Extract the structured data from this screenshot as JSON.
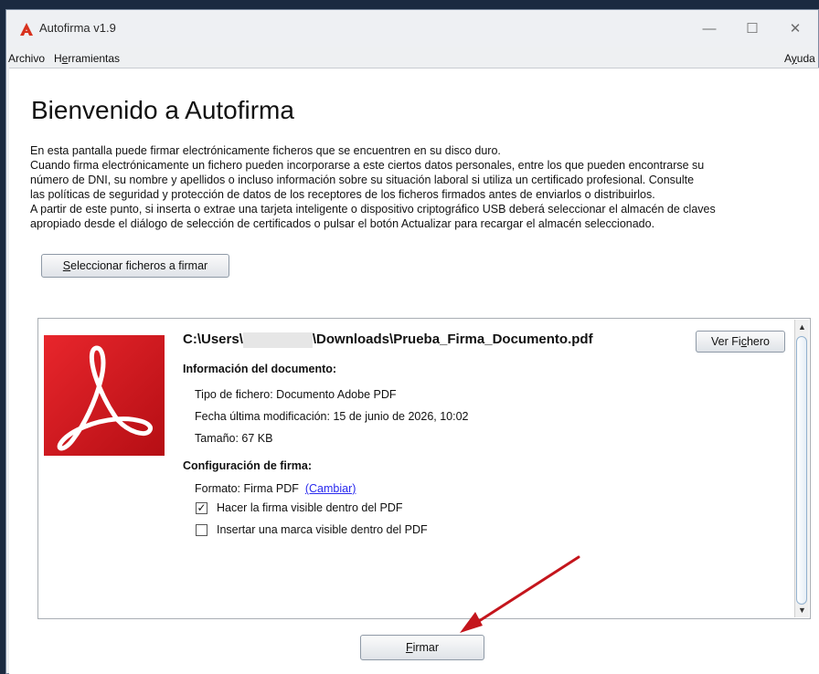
{
  "window": {
    "title": "Autofirma v1.9",
    "controls": {
      "minimize": "—",
      "maximize": "☐",
      "close": "✕"
    }
  },
  "menu": {
    "archivo": "Archivo",
    "herramientas_pre": "H",
    "herramientas_u": "e",
    "herramientas_post": "rramientas",
    "ayuda_pre": "A",
    "ayuda_u": "y",
    "ayuda_post": "uda"
  },
  "main": {
    "heading": "Bienvenido a Autofirma",
    "intro_lines": [
      "En esta pantalla puede firmar electrónicamente ficheros que se encuentren en su disco duro.",
      "Cuando firma electrónicamente un fichero pueden incorporarse a este ciertos datos personales, entre los que pueden encontrarse su",
      "número de DNI, su nombre y apellidos o incluso información sobre su situación laboral si utiliza un certificado profesional. Consulte",
      "las políticas de seguridad y protección de datos de los receptores de los ficheros firmados antes de enviarlos o distribuirlos.",
      "A partir de este punto, si inserta o extrae una tarjeta inteligente o dispositivo criptográfico USB deberá seleccionar el almacén de claves",
      "apropiado desde el diálogo de selección de certificados o pulsar el botón Actualizar para recargar el almacén seleccionado."
    ],
    "select_button_u": "S",
    "select_button_rest": "eleccionar ficheros a firmar"
  },
  "document": {
    "path_pre": "C:\\Users\\",
    "path_post": "\\Downloads\\Prueba_Firma_Documento.pdf",
    "ver_pre": "Ver Fi",
    "ver_u": "c",
    "ver_post": "hero",
    "info_title": "Información del documento:",
    "tipo": "Tipo de fichero: Documento Adobe PDF",
    "fecha": "Fecha última modificación: 15 de junio de 2026, 10:02",
    "tamano": "Tamaño: 67 KB",
    "config_title": "Configuración de firma:",
    "formato": "Formato: Firma PDF",
    "cambiar": "(Cambiar)",
    "checkbox1": {
      "label": "Hacer la firma visible dentro del PDF",
      "checked": true
    },
    "checkbox2": {
      "label": "Insertar una marca visible dentro del PDF",
      "checked": false
    }
  },
  "footer": {
    "firmar_u": "F",
    "firmar_rest": "irmar"
  },
  "colors": {
    "pdf_red": "#d9141b",
    "annotation_arrow": "#c4151c",
    "link": "#2a2aee"
  }
}
